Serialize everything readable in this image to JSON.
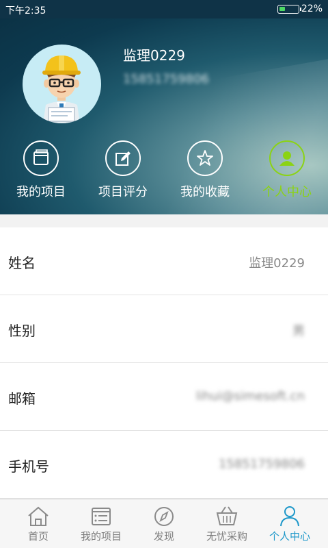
{
  "status_bar": {
    "time": "下午2:35",
    "battery_percent": "22%",
    "battery_level": 0.22
  },
  "profile": {
    "name": "监理0229",
    "phone": "15851759806"
  },
  "quick_nav": [
    {
      "label": "我的项目",
      "icon": "folder-icon",
      "active": false
    },
    {
      "label": "项目评分",
      "icon": "edit-icon",
      "active": false
    },
    {
      "label": "我的收藏",
      "icon": "star-icon",
      "active": false
    },
    {
      "label": "个人中心",
      "icon": "user-icon",
      "active": true
    }
  ],
  "info_rows": [
    {
      "key": "姓名",
      "value": "监理0229"
    },
    {
      "key": "性别",
      "value": "男"
    },
    {
      "key": "邮箱",
      "value": "lihui@simesoft.cn"
    },
    {
      "key": "手机号",
      "value": "15851759806"
    }
  ],
  "tab_bar": [
    {
      "label": "首页",
      "icon": "home-icon",
      "active": false
    },
    {
      "label": "我的项目",
      "icon": "list-icon",
      "active": false
    },
    {
      "label": "发现",
      "icon": "compass-icon",
      "active": false
    },
    {
      "label": "无忧采购",
      "icon": "basket-icon",
      "active": false
    },
    {
      "label": "个人中心",
      "icon": "person-icon",
      "active": true
    }
  ],
  "colors": {
    "header_dark": "#0d3a4f",
    "active_green": "#8bd313",
    "active_blue": "#1c97c9"
  }
}
